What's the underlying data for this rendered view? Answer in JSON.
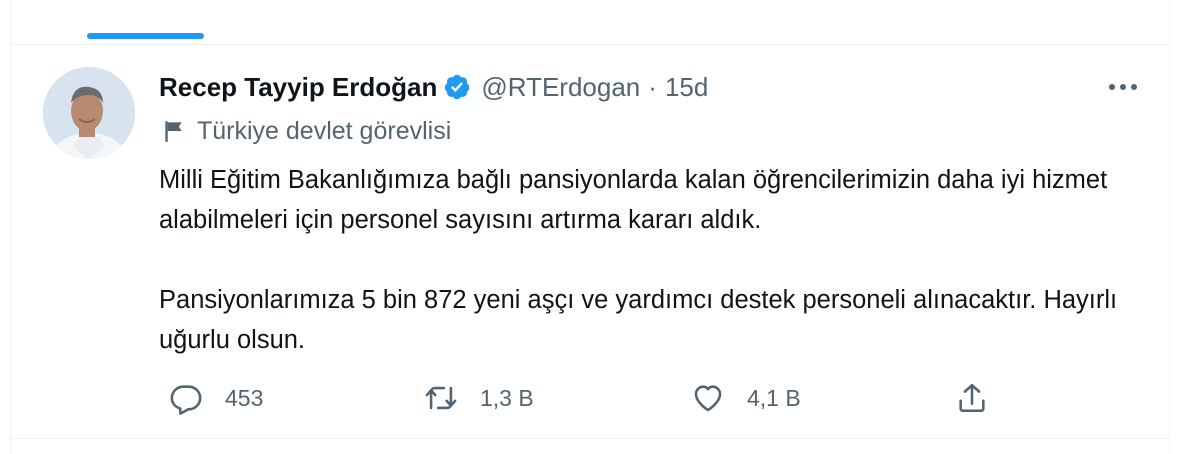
{
  "tweet": {
    "author_name": "Recep Tayyip Erdoğan",
    "handle": "@RTErdogan",
    "separator": "·",
    "time": "15d",
    "label": "Türkiye devlet görevlisi",
    "paragraphs": [
      "Milli Eğitim Bakanlığımıza bağlı pansiyonlarda kalan öğrencilerimizin daha iyi hizmet alabilmeleri için personel sayısını artırma kararı aldık.",
      "Pansiyonlarımıza 5 bin 872 yeni aşçı ve yardımcı destek personeli alınacaktır. Hayırlı uğurlu olsun."
    ],
    "stats": {
      "replies": "453",
      "retweets": "1,3 B",
      "likes": "4,1 B"
    }
  },
  "colors": {
    "accent": "#1d9bf0",
    "text": "#0f1419",
    "secondary": "#536471",
    "border": "#eff3f4"
  },
  "icons": {
    "verified": "verified-badge-icon",
    "label": "flag-icon",
    "more": "more-dots-icon",
    "reply": "reply-icon",
    "retweet": "retweet-icon",
    "like": "heart-icon",
    "share": "share-icon"
  }
}
